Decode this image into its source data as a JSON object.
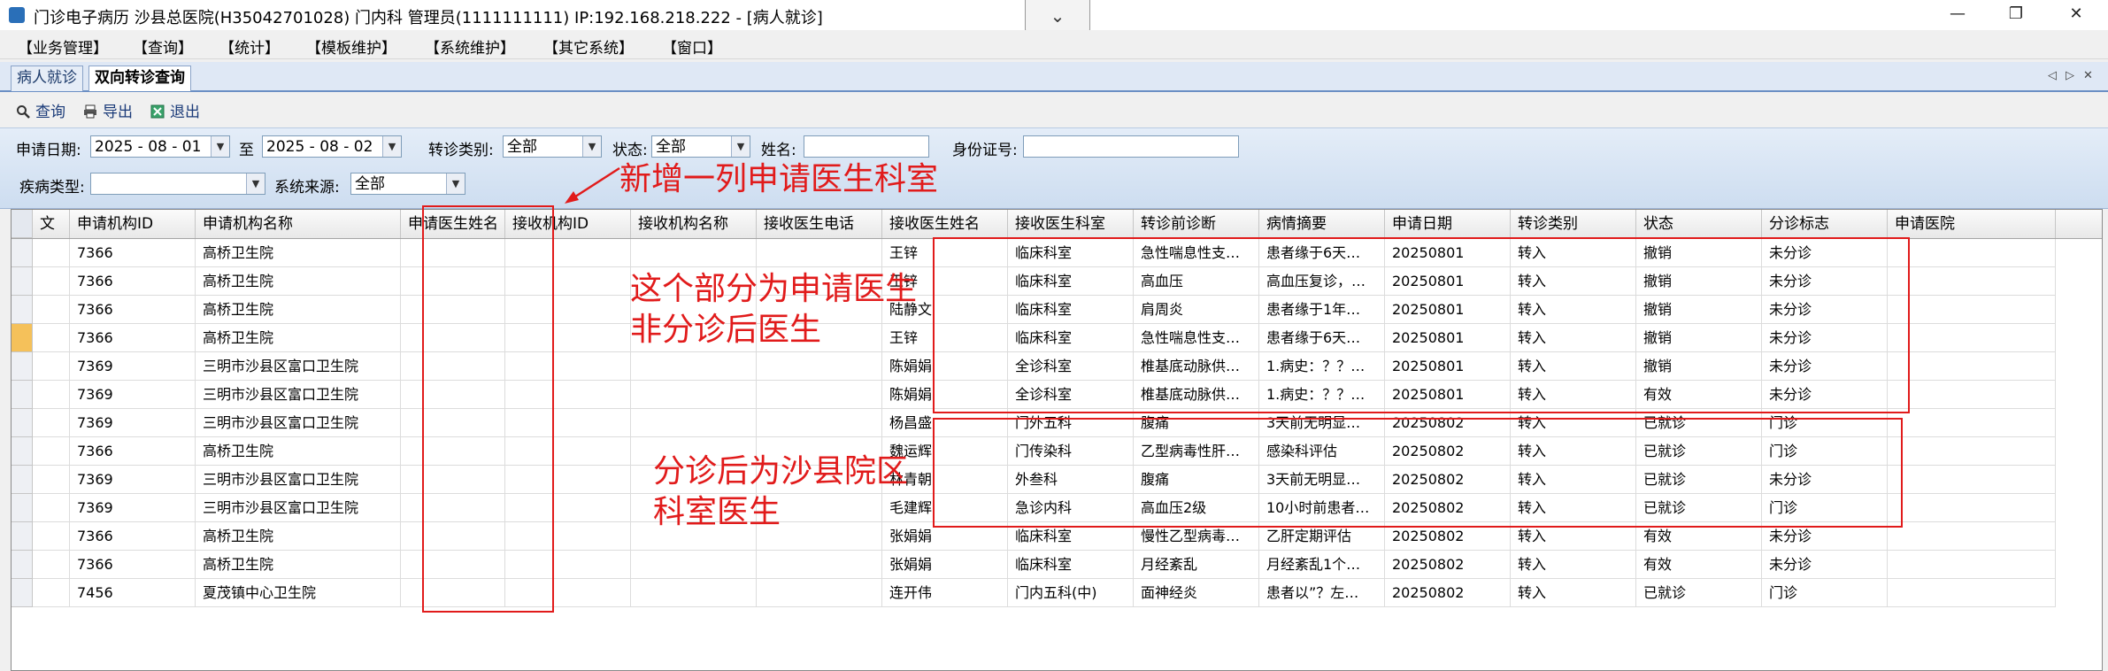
{
  "window": {
    "title": "门诊电子病历  沙县总医院(H35042701028)  门内科  管理员(1111111111) IP:192.168.218.222 - [病人就诊]",
    "collapse_glyph": "⌄",
    "minimize_glyph": "—",
    "restore_glyph": "❐",
    "close_glyph": "✕"
  },
  "menu": [
    "【业务管理】",
    "【查询】",
    "【统计】",
    "【模板维护】",
    "【系统维护】",
    "【其它系统】",
    "【窗口】"
  ],
  "tabs": [
    "病人就诊",
    "双向转诊查询"
  ],
  "tab_controls": [
    "◁",
    "▷",
    "✕"
  ],
  "toolbar": {
    "query": "查询",
    "export": "导出",
    "exit": "退出"
  },
  "filters": {
    "apply_date_label": "申请日期:",
    "date_from": "2025 - 08 - 01",
    "to_label": "至",
    "date_to": "2025 - 08 - 02",
    "referral_type_label": "转诊类别:",
    "referral_type_value": "全部",
    "status_label": "状态:",
    "status_value": "全部",
    "name_label": "姓名:",
    "name_value": "",
    "id_label": "身份证号:",
    "id_value": "",
    "disease_type_label": "疾病类型:",
    "disease_type_value": "",
    "source_label": "系统来源:",
    "source_value": "全部"
  },
  "columns": [
    "文",
    "申请机构ID",
    "申请机构名称",
    "申请医生姓名",
    "接收机构ID",
    "接收机构名称",
    "接收医生电话",
    "接收医生姓名",
    "接收医生科室",
    "转诊前诊断",
    "病情摘要",
    "申请日期",
    "转诊类别",
    "状态",
    "分诊标志",
    "申请医院"
  ],
  "rows": [
    [
      "",
      "7366",
      "高桥卫生院",
      "",
      "",
      "",
      "",
      "王锌",
      "临床科室",
      "急性喘息性支…",
      "患者缘于6天…",
      "20250801",
      "转入",
      "撤销",
      "未分诊",
      ""
    ],
    [
      "",
      "7366",
      "高桥卫生院",
      "",
      "",
      "",
      "",
      "王锌",
      "临床科室",
      "高血压",
      "高血压复诊，…",
      "20250801",
      "转入",
      "撤销",
      "未分诊",
      ""
    ],
    [
      "",
      "7366",
      "高桥卫生院",
      "",
      "",
      "",
      "",
      "陆静文",
      "临床科室",
      "肩周炎",
      "患者缘于1年…",
      "20250801",
      "转入",
      "撤销",
      "未分诊",
      ""
    ],
    [
      "",
      "7366",
      "高桥卫生院",
      "",
      "",
      "",
      "",
      "王锌",
      "临床科室",
      "急性喘息性支…",
      "患者缘于6天…",
      "20250801",
      "转入",
      "撤销",
      "未分诊",
      ""
    ],
    [
      "",
      "7369",
      "三明市沙县区富口卫生院",
      "",
      "",
      "",
      "",
      "陈娟娟",
      "全诊科室",
      "椎基底动脉供…",
      "1.病史：？？…",
      "20250801",
      "转入",
      "撤销",
      "未分诊",
      ""
    ],
    [
      "",
      "7369",
      "三明市沙县区富口卫生院",
      "",
      "",
      "",
      "",
      "陈娟娟",
      "全诊科室",
      "椎基底动脉供…",
      "1.病史：？？…",
      "20250801",
      "转入",
      "有效",
      "未分诊",
      ""
    ],
    [
      "",
      "7369",
      "三明市沙县区富口卫生院",
      "",
      "",
      "",
      "",
      "杨昌盛",
      "门外五科",
      "腹痛",
      "3天前无明显…",
      "20250802",
      "转入",
      "已就诊",
      "门诊",
      ""
    ],
    [
      "",
      "7366",
      "高桥卫生院",
      "",
      "",
      "",
      "",
      "魏运辉",
      "门传染科",
      "乙型病毒性肝…",
      "感染科评估",
      "20250802",
      "转入",
      "已就诊",
      "门诊",
      ""
    ],
    [
      "",
      "7369",
      "三明市沙县区富口卫生院",
      "",
      "",
      "",
      "",
      "林青朝",
      "外叁科",
      "腹痛",
      "3天前无明显…",
      "20250802",
      "转入",
      "已就诊",
      "未分诊",
      ""
    ],
    [
      "",
      "7369",
      "三明市沙县区富口卫生院",
      "",
      "",
      "",
      "",
      "毛建辉",
      "急诊内科",
      "高血压2级",
      "10小时前患者…",
      "20250802",
      "转入",
      "已就诊",
      "门诊",
      ""
    ],
    [
      "",
      "7366",
      "高桥卫生院",
      "",
      "",
      "",
      "",
      "张娟娟",
      "临床科室",
      "慢性乙型病毒…",
      "乙肝定期评估",
      "20250802",
      "转入",
      "有效",
      "未分诊",
      ""
    ],
    [
      "",
      "7366",
      "高桥卫生院",
      "",
      "",
      "",
      "",
      "张娟娟",
      "临床科室",
      "月经紊乱",
      "月经紊乱1个…",
      "20250802",
      "转入",
      "有效",
      "未分诊",
      ""
    ],
    [
      "",
      "7456",
      "夏茂镇中心卫生院",
      "",
      "",
      "",
      "",
      "连开伟",
      "门内五科(中)",
      "面神经炎",
      "患者以”？左…",
      "20250802",
      "转入",
      "已就诊",
      "门诊",
      ""
    ]
  ],
  "annotations": {
    "new_column_note": "新增一列申请医生科室",
    "note_upper_line1": "这个部分为申请医生",
    "note_upper_line2": "非分诊后医生",
    "note_lower_line1": "分诊后为沙县院区",
    "note_lower_line2": "科室医生"
  },
  "colors": {
    "annotation": "#e11b1b",
    "selected_row_marker": "#f5c15a",
    "filter_bg": "#cdddf0"
  }
}
